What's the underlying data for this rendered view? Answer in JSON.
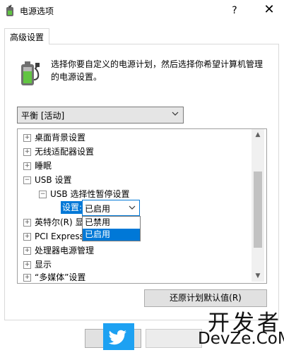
{
  "window": {
    "title": "电源选项",
    "help_label": "?",
    "close_label": "✕"
  },
  "tab": {
    "label": "高级设置"
  },
  "description": "选择你要自定义的电源计划，然后选择你希望计算机管理的电源设置。",
  "plan_select": {
    "value": "平衡 [活动]"
  },
  "tree": {
    "items": [
      {
        "expander": "+",
        "label": "桌面背景设置"
      },
      {
        "expander": "+",
        "label": "无线适配器设置"
      },
      {
        "expander": "+",
        "label": "睡眠"
      },
      {
        "expander": "−",
        "label": "USB 设置"
      },
      {
        "expander": "−",
        "label": "USB 选择性暂停设置"
      },
      {
        "expander": "+",
        "label": "英特尔(R) 显"
      },
      {
        "expander": "+",
        "label": "PCI Express"
      },
      {
        "expander": "+",
        "label": "处理器电源管理"
      },
      {
        "expander": "+",
        "label": "显示"
      },
      {
        "expander": "+",
        "label": "“多媒体”设置"
      }
    ],
    "setting_label": "设置:",
    "setting_value": "已启用",
    "options": [
      "已禁用",
      "已启用"
    ],
    "selected_option": "已启用"
  },
  "restore_button": "还原计划默认值(R)",
  "watermark": {
    "line1": "开发者",
    "line2": "DevZe.CoM"
  },
  "colors": {
    "accent": "#0078d7",
    "twitter": "#1da1f2"
  },
  "icons": [
    "app-power-icon",
    "battery-plug-icon",
    "chevron-down-icon",
    "twitter-bird-icon"
  ]
}
